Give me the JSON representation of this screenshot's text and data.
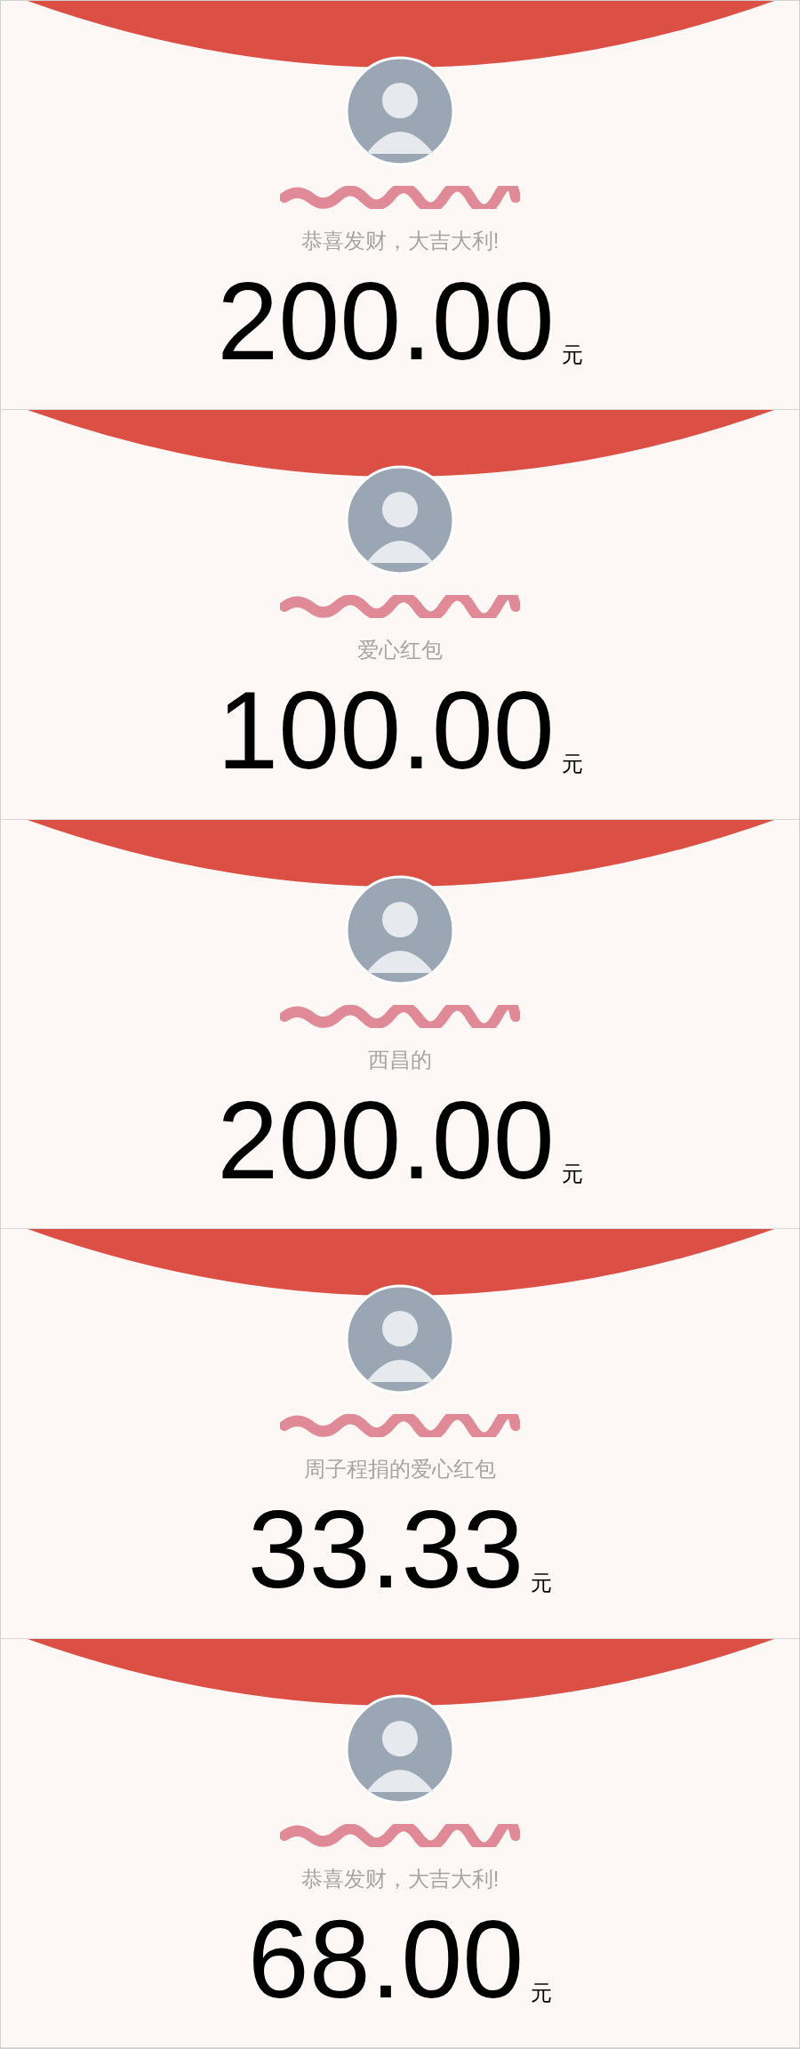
{
  "packets": [
    {
      "blessing": "恭喜发财，大吉大利!",
      "amount": "200.00",
      "currency": "元"
    },
    {
      "blessing": "爱心红包",
      "amount": "100.00",
      "currency": "元"
    },
    {
      "blessing": "西昌的",
      "amount": "200.00",
      "currency": "元"
    },
    {
      "blessing": "周子程捐的爱心红包",
      "amount": "33.33",
      "currency": "元"
    },
    {
      "blessing": "恭喜发财，大吉大利!",
      "amount": "68.00",
      "currency": "元"
    }
  ]
}
